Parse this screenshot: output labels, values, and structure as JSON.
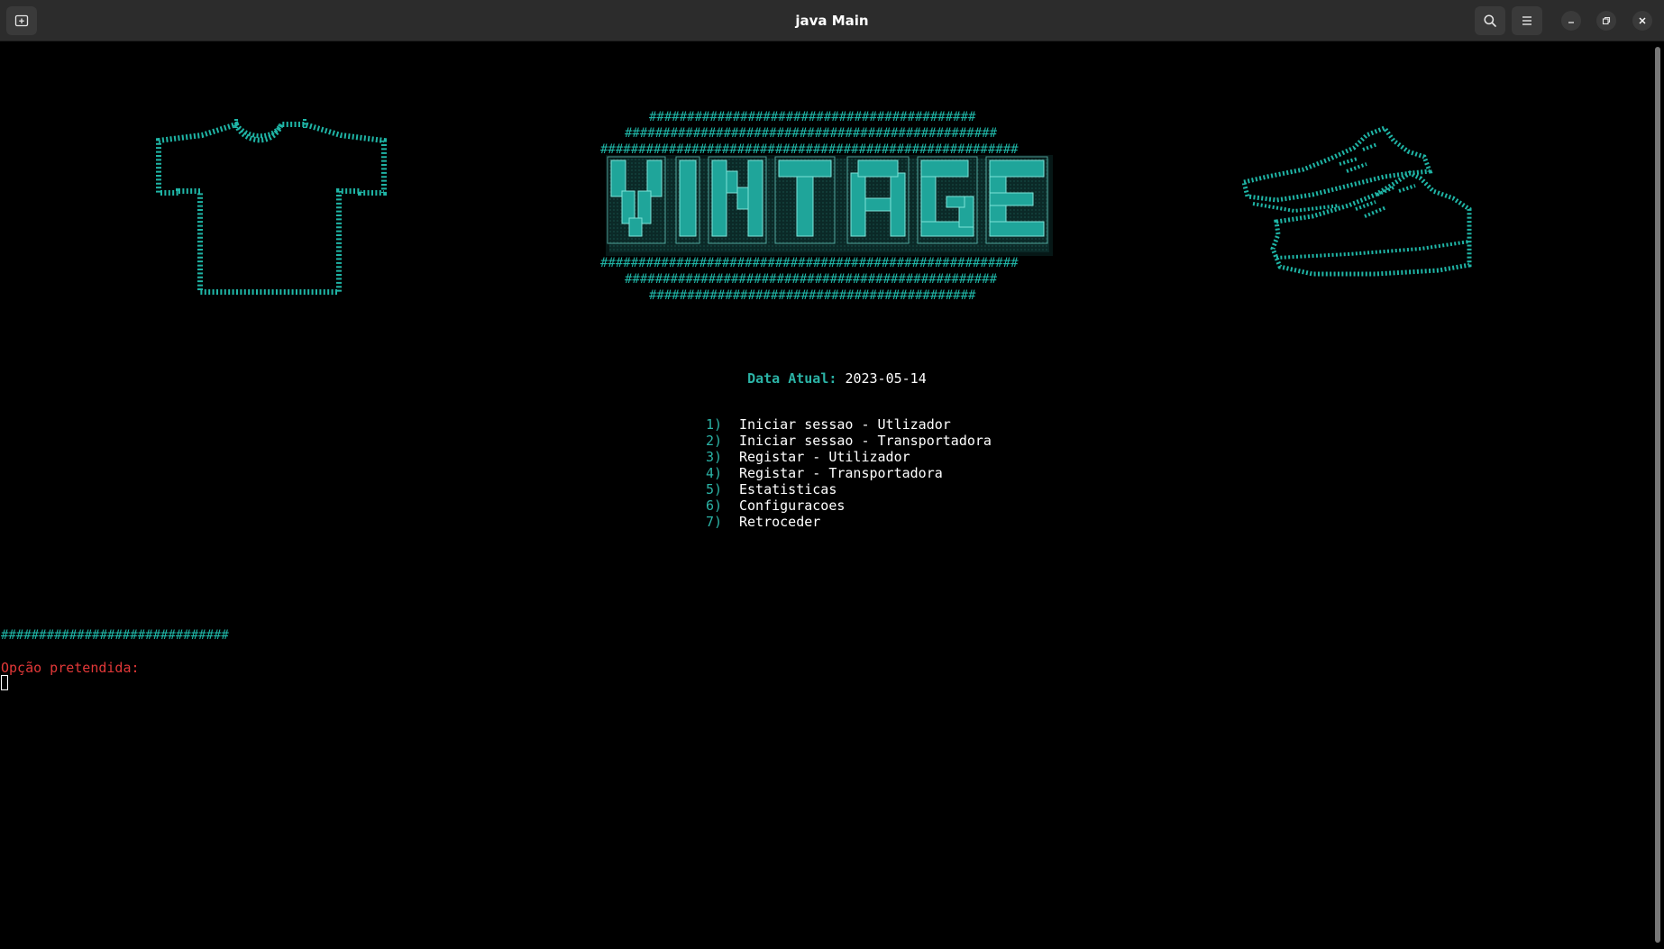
{
  "window": {
    "title": "java Main",
    "new_tab_icon": "new-tab-icon",
    "search_icon": "search-icon",
    "menu_icon": "hamburger-menu-icon",
    "minimize_icon": "minimize-icon",
    "maximize_icon": "maximize-icon",
    "close_icon": "close-icon"
  },
  "terminal": {
    "logo": {
      "word": "VINTAGE",
      "hash_row_1": "###########################################",
      "hash_row_2": "#################################################",
      "hash_row_3": "#######################################################",
      "hash_row_4": "#######################################################",
      "hash_row_5": "#################################################",
      "hash_row_6": "###########################################"
    },
    "date": {
      "label": "Data Atual:",
      "value": "2023-05-14"
    },
    "menu": [
      {
        "number": "1)",
        "label": "Iniciar sessao - Utlizador"
      },
      {
        "number": "2)",
        "label": "Iniciar sessao - Transportadora"
      },
      {
        "number": "3)",
        "label": "Registar - Utilizador"
      },
      {
        "number": "4)",
        "label": "Registar - Transportadora"
      },
      {
        "number": "5)",
        "label": "Estatisticas"
      },
      {
        "number": "6)",
        "label": "Configuracoes"
      },
      {
        "number": "7)",
        "label": "Retroceder"
      }
    ],
    "separator": "##############################",
    "prompt": "Opção pretendida:",
    "colors": {
      "accent": "#2bb3a6",
      "prompt": "#e23838",
      "background": "#000000",
      "text": "#ffffff"
    },
    "art_icons": [
      "t-shirt-icon",
      "sneaker-icon"
    ]
  }
}
